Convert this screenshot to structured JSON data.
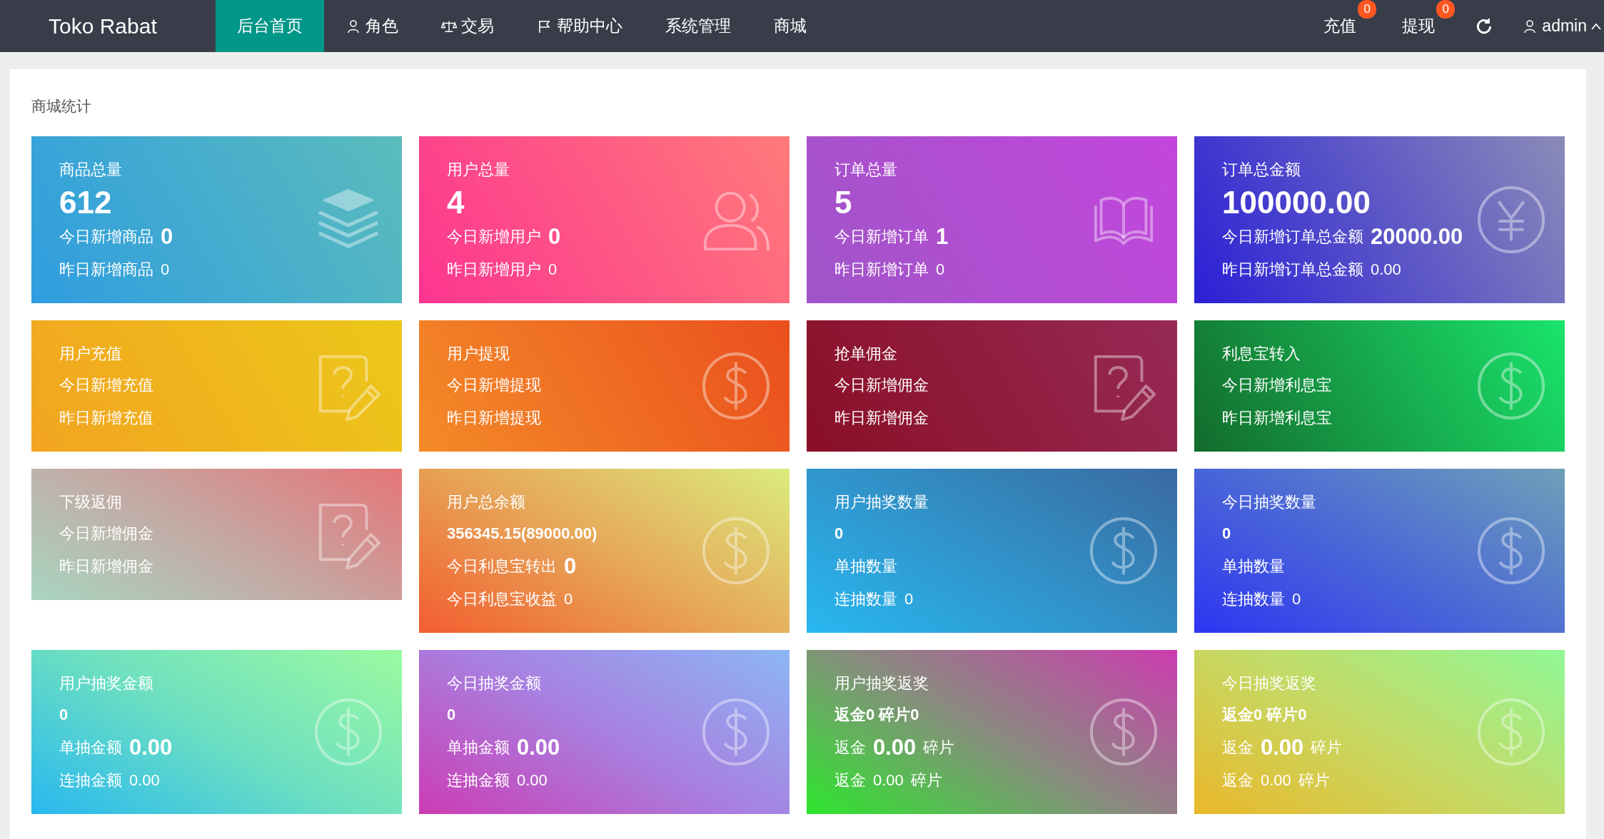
{
  "nav": {
    "brand": "Toko Rabat",
    "menu": [
      {
        "label": "后台首页",
        "kind": "plain",
        "selected": true
      },
      {
        "label": "角色",
        "kind": "user",
        "selected": false
      },
      {
        "label": "交易",
        "kind": "scale",
        "selected": false
      },
      {
        "label": "帮助中心",
        "kind": "flag",
        "selected": false
      },
      {
        "label": "系统管理",
        "kind": "plain",
        "selected": false
      },
      {
        "label": "商城",
        "kind": "plain",
        "selected": false
      }
    ],
    "actions": [
      {
        "label": "充值",
        "badge": "0"
      },
      {
        "label": "提现",
        "badge": "0"
      }
    ],
    "user": "admin"
  },
  "section_title": "商城统计",
  "cards": [
    {
      "title": "商品总量",
      "kind": "layers",
      "lines": [
        [
          {
            "text": "612",
            "kind": "hero"
          }
        ],
        [
          {
            "text": "今日新增商品",
            "kind": "plain"
          },
          {
            "text": "0",
            "kind": "big"
          }
        ],
        [
          {
            "text": "昨日新增商品",
            "kind": "plain"
          },
          {
            "text": "0",
            "kind": "plain"
          }
        ]
      ]
    },
    {
      "title": "用户总量",
      "kind": "users",
      "lines": [
        [
          {
            "text": "4",
            "kind": "hero"
          }
        ],
        [
          {
            "text": "今日新增用户",
            "kind": "plain"
          },
          {
            "text": "0",
            "kind": "big"
          }
        ],
        [
          {
            "text": "昨日新增用户",
            "kind": "plain"
          },
          {
            "text": "0",
            "kind": "plain"
          }
        ]
      ]
    },
    {
      "title": "订单总量",
      "kind": "book",
      "lines": [
        [
          {
            "text": "5",
            "kind": "hero"
          }
        ],
        [
          {
            "text": "今日新增订单",
            "kind": "plain"
          },
          {
            "text": "1",
            "kind": "big"
          }
        ],
        [
          {
            "text": "昨日新增订单",
            "kind": "plain"
          },
          {
            "text": "0",
            "kind": "plain"
          }
        ]
      ]
    },
    {
      "title": "订单总金额",
      "kind": "yen",
      "lines": [
        [
          {
            "text": "100000.00",
            "kind": "hero"
          }
        ],
        [
          {
            "text": "今日新增订单总金额",
            "kind": "plain"
          },
          {
            "text": "20000.00",
            "kind": "big"
          }
        ],
        [
          {
            "text": "昨日新增订单总金额",
            "kind": "plain"
          },
          {
            "text": "0.00",
            "kind": "plain"
          }
        ]
      ]
    },
    {
      "title": "用户充值",
      "kind": "note",
      "lines": [
        [
          {
            "text": "今日新增充值",
            "kind": "plain"
          }
        ],
        [
          {
            "text": "昨日新增充值",
            "kind": "plain"
          }
        ]
      ]
    },
    {
      "title": "用户提现",
      "kind": "dollar",
      "lines": [
        [
          {
            "text": "今日新增提现",
            "kind": "plain"
          }
        ],
        [
          {
            "text": "昨日新增提现",
            "kind": "plain"
          }
        ]
      ]
    },
    {
      "title": "抢单佣金",
      "kind": "note",
      "lines": [
        [
          {
            "text": "今日新增佣金",
            "kind": "plain"
          }
        ],
        [
          {
            "text": "昨日新增佣金",
            "kind": "plain"
          }
        ]
      ]
    },
    {
      "title": "利息宝转入",
      "kind": "dollar",
      "lines": [
        [
          {
            "text": "今日新增利息宝",
            "kind": "plain"
          }
        ],
        [
          {
            "text": "昨日新增利息宝",
            "kind": "plain"
          }
        ]
      ]
    },
    {
      "title": "下级返佣",
      "kind": "note",
      "lines": [
        [
          {
            "text": "今日新增佣金",
            "kind": "plain"
          }
        ],
        [
          {
            "text": "昨日新增佣金",
            "kind": "plain"
          }
        ]
      ]
    },
    {
      "title": "用户总余额",
      "kind": "dollar",
      "lines": [
        [
          {
            "text": "356345.15(89000.00)",
            "kind": "strong"
          }
        ],
        [
          {
            "text": "今日利息宝转出",
            "kind": "plain"
          },
          {
            "text": "0",
            "kind": "big"
          }
        ],
        [
          {
            "text": "今日利息宝收益",
            "kind": "plain"
          },
          {
            "text": "0",
            "kind": "plain"
          }
        ]
      ]
    },
    {
      "title": "用户抽奖数量",
      "kind": "dollar",
      "lines": [
        [
          {
            "text": "0",
            "kind": "strong"
          }
        ],
        [
          {
            "text": "单抽数量",
            "kind": "plain"
          }
        ],
        [
          {
            "text": "连抽数量",
            "kind": "plain"
          },
          {
            "text": "0",
            "kind": "plain"
          }
        ]
      ]
    },
    {
      "title": "今日抽奖数量",
      "kind": "dollar",
      "lines": [
        [
          {
            "text": "0",
            "kind": "strong"
          }
        ],
        [
          {
            "text": "单抽数量",
            "kind": "plain"
          }
        ],
        [
          {
            "text": "连抽数量",
            "kind": "plain"
          },
          {
            "text": "0",
            "kind": "plain"
          }
        ]
      ]
    },
    {
      "title": "用户抽奖金额",
      "kind": "dollar",
      "lines": [
        [
          {
            "text": "0",
            "kind": "strong"
          }
        ],
        [
          {
            "text": "单抽金额",
            "kind": "plain"
          },
          {
            "text": "0.00",
            "kind": "big"
          }
        ],
        [
          {
            "text": "连抽金额",
            "kind": "plain"
          },
          {
            "text": "0.00",
            "kind": "plain"
          }
        ]
      ]
    },
    {
      "title": "今日抽奖金额",
      "kind": "dollar",
      "lines": [
        [
          {
            "text": "0",
            "kind": "strong"
          }
        ],
        [
          {
            "text": "单抽金额",
            "kind": "plain"
          },
          {
            "text": "0.00",
            "kind": "big"
          }
        ],
        [
          {
            "text": "连抽金额",
            "kind": "plain"
          },
          {
            "text": "0.00",
            "kind": "plain"
          }
        ]
      ]
    },
    {
      "title": "用户抽奖返奖",
      "kind": "dollar",
      "lines": [
        [
          {
            "text": "返金0 碎片0",
            "kind": "strong"
          }
        ],
        [
          {
            "text": "返金",
            "kind": "plain"
          },
          {
            "text": "0.00",
            "kind": "big"
          },
          {
            "text": "碎片",
            "kind": "plain"
          }
        ],
        [
          {
            "text": "返金",
            "kind": "plain"
          },
          {
            "text": "0.00",
            "kind": "plain"
          },
          {
            "text": "碎片",
            "kind": "plain"
          }
        ]
      ]
    },
    {
      "title": "今日抽奖返奖",
      "kind": "dollar",
      "lines": [
        [
          {
            "text": "返金0 碎片0",
            "kind": "strong"
          }
        ],
        [
          {
            "text": "返金",
            "kind": "plain"
          },
          {
            "text": "0.00",
            "kind": "big"
          },
          {
            "text": "碎片",
            "kind": "plain"
          }
        ],
        [
          {
            "text": "返金",
            "kind": "plain"
          },
          {
            "text": "0.00",
            "kind": "plain"
          },
          {
            "text": "碎片",
            "kind": "plain"
          }
        ]
      ]
    }
  ]
}
